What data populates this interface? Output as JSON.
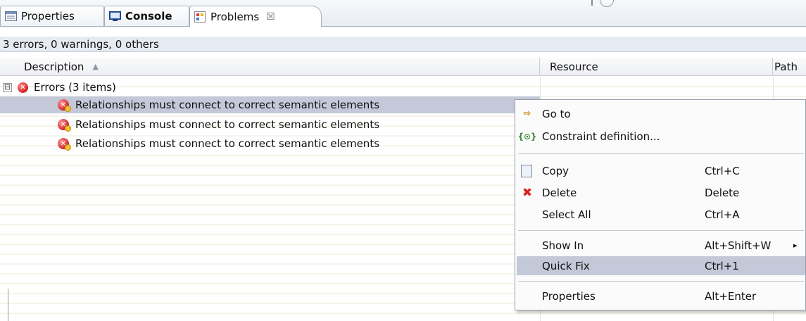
{
  "tabs": [
    {
      "label": "Properties",
      "icon": "properties-icon"
    },
    {
      "label": "Console",
      "icon": "console-icon"
    },
    {
      "label": "Problems",
      "icon": "problems-icon",
      "close": "☒"
    }
  ],
  "summary": "3 errors, 0 warnings, 0 others",
  "columns": {
    "description": "Description",
    "resource": "Resource",
    "path": "Path"
  },
  "group": {
    "label": "Errors (3 items)",
    "expander": "⊟"
  },
  "items": [
    "Relationships must connect to correct semantic elements",
    "Relationships must connect to correct semantic elements",
    "Relationships must connect to correct semantic elements"
  ],
  "menu": {
    "goto": {
      "label": "Go to",
      "icon": "go-to-icon"
    },
    "constraint": {
      "label": "Constraint definition...",
      "icon": "constraint-icon"
    },
    "copy": {
      "label": "Copy",
      "shortcut": "Ctrl+C",
      "icon": "copy-icon"
    },
    "delete": {
      "label": "Delete",
      "shortcut": "Delete",
      "icon": "delete-icon"
    },
    "select_all": {
      "label": "Select All",
      "shortcut": "Ctrl+A"
    },
    "show_in": {
      "label": "Show In",
      "shortcut": "Alt+Shift+W",
      "submenu": "▸"
    },
    "quick_fix": {
      "label": "Quick Fix",
      "shortcut": "Ctrl+1"
    },
    "properties": {
      "label": "Properties",
      "shortcut": "Alt+Enter"
    }
  },
  "colors": {
    "selection": "#c3c9d9",
    "error": "#d81e1e"
  }
}
